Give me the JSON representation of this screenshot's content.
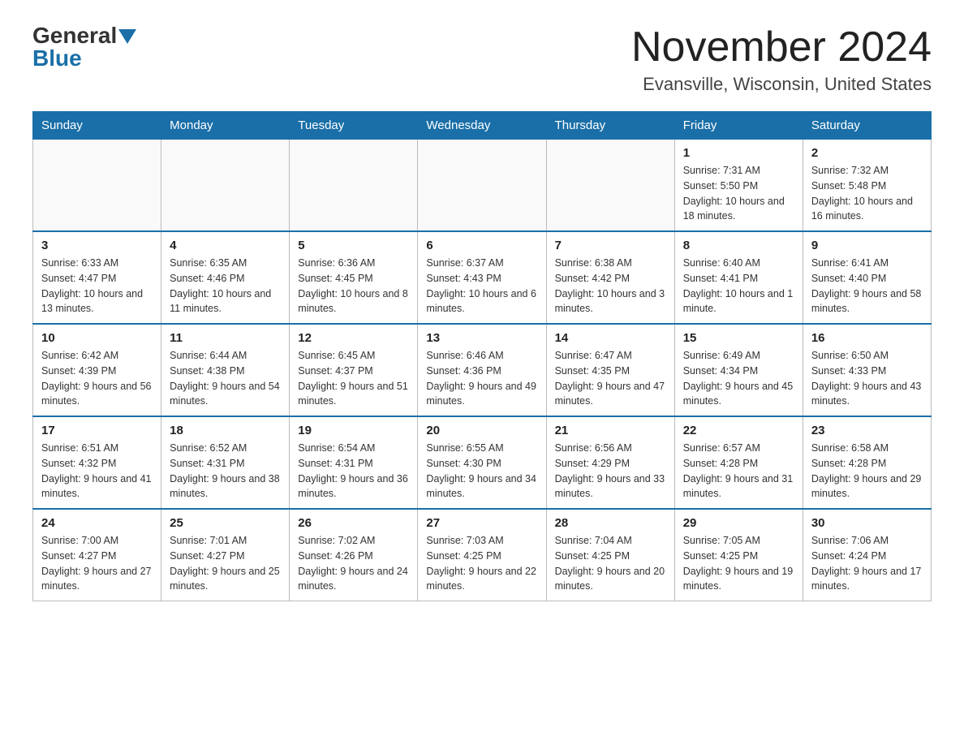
{
  "header": {
    "logo_general": "General",
    "logo_blue": "Blue",
    "title": "November 2024",
    "subtitle": "Evansville, Wisconsin, United States"
  },
  "weekdays": [
    "Sunday",
    "Monday",
    "Tuesday",
    "Wednesday",
    "Thursday",
    "Friday",
    "Saturday"
  ],
  "weeks": [
    [
      {
        "day": "",
        "sunrise": "",
        "sunset": "",
        "daylight": ""
      },
      {
        "day": "",
        "sunrise": "",
        "sunset": "",
        "daylight": ""
      },
      {
        "day": "",
        "sunrise": "",
        "sunset": "",
        "daylight": ""
      },
      {
        "day": "",
        "sunrise": "",
        "sunset": "",
        "daylight": ""
      },
      {
        "day": "",
        "sunrise": "",
        "sunset": "",
        "daylight": ""
      },
      {
        "day": "1",
        "sunrise": "Sunrise: 7:31 AM",
        "sunset": "Sunset: 5:50 PM",
        "daylight": "Daylight: 10 hours and 18 minutes."
      },
      {
        "day": "2",
        "sunrise": "Sunrise: 7:32 AM",
        "sunset": "Sunset: 5:48 PM",
        "daylight": "Daylight: 10 hours and 16 minutes."
      }
    ],
    [
      {
        "day": "3",
        "sunrise": "Sunrise: 6:33 AM",
        "sunset": "Sunset: 4:47 PM",
        "daylight": "Daylight: 10 hours and 13 minutes."
      },
      {
        "day": "4",
        "sunrise": "Sunrise: 6:35 AM",
        "sunset": "Sunset: 4:46 PM",
        "daylight": "Daylight: 10 hours and 11 minutes."
      },
      {
        "day": "5",
        "sunrise": "Sunrise: 6:36 AM",
        "sunset": "Sunset: 4:45 PM",
        "daylight": "Daylight: 10 hours and 8 minutes."
      },
      {
        "day": "6",
        "sunrise": "Sunrise: 6:37 AM",
        "sunset": "Sunset: 4:43 PM",
        "daylight": "Daylight: 10 hours and 6 minutes."
      },
      {
        "day": "7",
        "sunrise": "Sunrise: 6:38 AM",
        "sunset": "Sunset: 4:42 PM",
        "daylight": "Daylight: 10 hours and 3 minutes."
      },
      {
        "day": "8",
        "sunrise": "Sunrise: 6:40 AM",
        "sunset": "Sunset: 4:41 PM",
        "daylight": "Daylight: 10 hours and 1 minute."
      },
      {
        "day": "9",
        "sunrise": "Sunrise: 6:41 AM",
        "sunset": "Sunset: 4:40 PM",
        "daylight": "Daylight: 9 hours and 58 minutes."
      }
    ],
    [
      {
        "day": "10",
        "sunrise": "Sunrise: 6:42 AM",
        "sunset": "Sunset: 4:39 PM",
        "daylight": "Daylight: 9 hours and 56 minutes."
      },
      {
        "day": "11",
        "sunrise": "Sunrise: 6:44 AM",
        "sunset": "Sunset: 4:38 PM",
        "daylight": "Daylight: 9 hours and 54 minutes."
      },
      {
        "day": "12",
        "sunrise": "Sunrise: 6:45 AM",
        "sunset": "Sunset: 4:37 PM",
        "daylight": "Daylight: 9 hours and 51 minutes."
      },
      {
        "day": "13",
        "sunrise": "Sunrise: 6:46 AM",
        "sunset": "Sunset: 4:36 PM",
        "daylight": "Daylight: 9 hours and 49 minutes."
      },
      {
        "day": "14",
        "sunrise": "Sunrise: 6:47 AM",
        "sunset": "Sunset: 4:35 PM",
        "daylight": "Daylight: 9 hours and 47 minutes."
      },
      {
        "day": "15",
        "sunrise": "Sunrise: 6:49 AM",
        "sunset": "Sunset: 4:34 PM",
        "daylight": "Daylight: 9 hours and 45 minutes."
      },
      {
        "day": "16",
        "sunrise": "Sunrise: 6:50 AM",
        "sunset": "Sunset: 4:33 PM",
        "daylight": "Daylight: 9 hours and 43 minutes."
      }
    ],
    [
      {
        "day": "17",
        "sunrise": "Sunrise: 6:51 AM",
        "sunset": "Sunset: 4:32 PM",
        "daylight": "Daylight: 9 hours and 41 minutes."
      },
      {
        "day": "18",
        "sunrise": "Sunrise: 6:52 AM",
        "sunset": "Sunset: 4:31 PM",
        "daylight": "Daylight: 9 hours and 38 minutes."
      },
      {
        "day": "19",
        "sunrise": "Sunrise: 6:54 AM",
        "sunset": "Sunset: 4:31 PM",
        "daylight": "Daylight: 9 hours and 36 minutes."
      },
      {
        "day": "20",
        "sunrise": "Sunrise: 6:55 AM",
        "sunset": "Sunset: 4:30 PM",
        "daylight": "Daylight: 9 hours and 34 minutes."
      },
      {
        "day": "21",
        "sunrise": "Sunrise: 6:56 AM",
        "sunset": "Sunset: 4:29 PM",
        "daylight": "Daylight: 9 hours and 33 minutes."
      },
      {
        "day": "22",
        "sunrise": "Sunrise: 6:57 AM",
        "sunset": "Sunset: 4:28 PM",
        "daylight": "Daylight: 9 hours and 31 minutes."
      },
      {
        "day": "23",
        "sunrise": "Sunrise: 6:58 AM",
        "sunset": "Sunset: 4:28 PM",
        "daylight": "Daylight: 9 hours and 29 minutes."
      }
    ],
    [
      {
        "day": "24",
        "sunrise": "Sunrise: 7:00 AM",
        "sunset": "Sunset: 4:27 PM",
        "daylight": "Daylight: 9 hours and 27 minutes."
      },
      {
        "day": "25",
        "sunrise": "Sunrise: 7:01 AM",
        "sunset": "Sunset: 4:27 PM",
        "daylight": "Daylight: 9 hours and 25 minutes."
      },
      {
        "day": "26",
        "sunrise": "Sunrise: 7:02 AM",
        "sunset": "Sunset: 4:26 PM",
        "daylight": "Daylight: 9 hours and 24 minutes."
      },
      {
        "day": "27",
        "sunrise": "Sunrise: 7:03 AM",
        "sunset": "Sunset: 4:25 PM",
        "daylight": "Daylight: 9 hours and 22 minutes."
      },
      {
        "day": "28",
        "sunrise": "Sunrise: 7:04 AM",
        "sunset": "Sunset: 4:25 PM",
        "daylight": "Daylight: 9 hours and 20 minutes."
      },
      {
        "day": "29",
        "sunrise": "Sunrise: 7:05 AM",
        "sunset": "Sunset: 4:25 PM",
        "daylight": "Daylight: 9 hours and 19 minutes."
      },
      {
        "day": "30",
        "sunrise": "Sunrise: 7:06 AM",
        "sunset": "Sunset: 4:24 PM",
        "daylight": "Daylight: 9 hours and 17 minutes."
      }
    ]
  ]
}
